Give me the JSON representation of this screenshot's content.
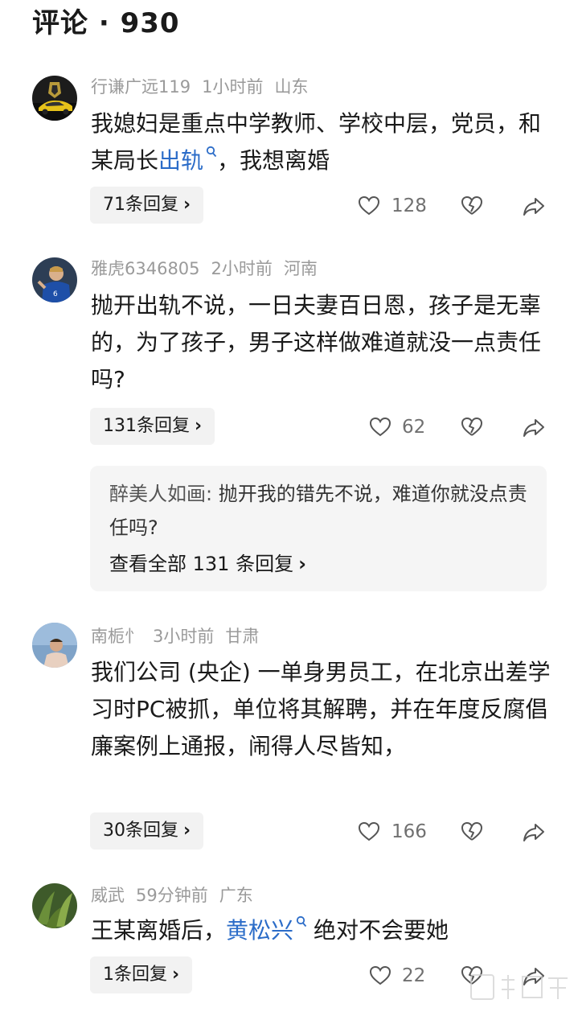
{
  "header": {
    "title": "评论 · 930"
  },
  "comments": [
    {
      "username": "行谦广远119",
      "time": "1小时前",
      "location": "山东",
      "text_before": "我媳妇是重点中学教师、学校中层，党员，和某局长",
      "link": "出轨",
      "text_after": "，我想离婚",
      "replies_label": "71条回复",
      "likes": "128"
    },
    {
      "username": "雅虎6346805",
      "time": "2小时前",
      "location": "河南",
      "text": "抛开出轨不说，一日夫妻百日恩，孩子是无辜的，为了孩子，男子这样做难道就没一点责任吗?",
      "replies_label": "131条回复",
      "likes": "62",
      "sub_reply": {
        "author": "醉美人如画:",
        "text": " 抛开我的错先不说，难道你就没点责任吗?",
        "view_all": "查看全部 131 条回复"
      }
    },
    {
      "username": "南栀忄",
      "time": "3小时前",
      "location": "甘肃",
      "text": "我们公司 (央企) 一单身男员工，在北京出差学习时PC被抓，单位将其解聘，并在年度反腐倡廉案例上通报，闹得人尽皆知，",
      "replies_label": "30条回复",
      "likes": "166"
    },
    {
      "username": "威武",
      "time": "59分钟前",
      "location": "广东",
      "text_before": "王某离婚后，",
      "link": "黄松兴",
      "text_after": "绝对不会要她",
      "replies_label": "1条回复",
      "likes": "22"
    }
  ],
  "icons": {
    "like": "heart-outline-icon",
    "dislike": "broken-heart-icon",
    "share": "share-arrow-icon",
    "search": "search-icon",
    "chevron": "chevron-right-icon"
  },
  "colors": {
    "link": "#2b6cc8",
    "meta": "#9a9a9a",
    "reply_bg": "#f2f2f2"
  }
}
